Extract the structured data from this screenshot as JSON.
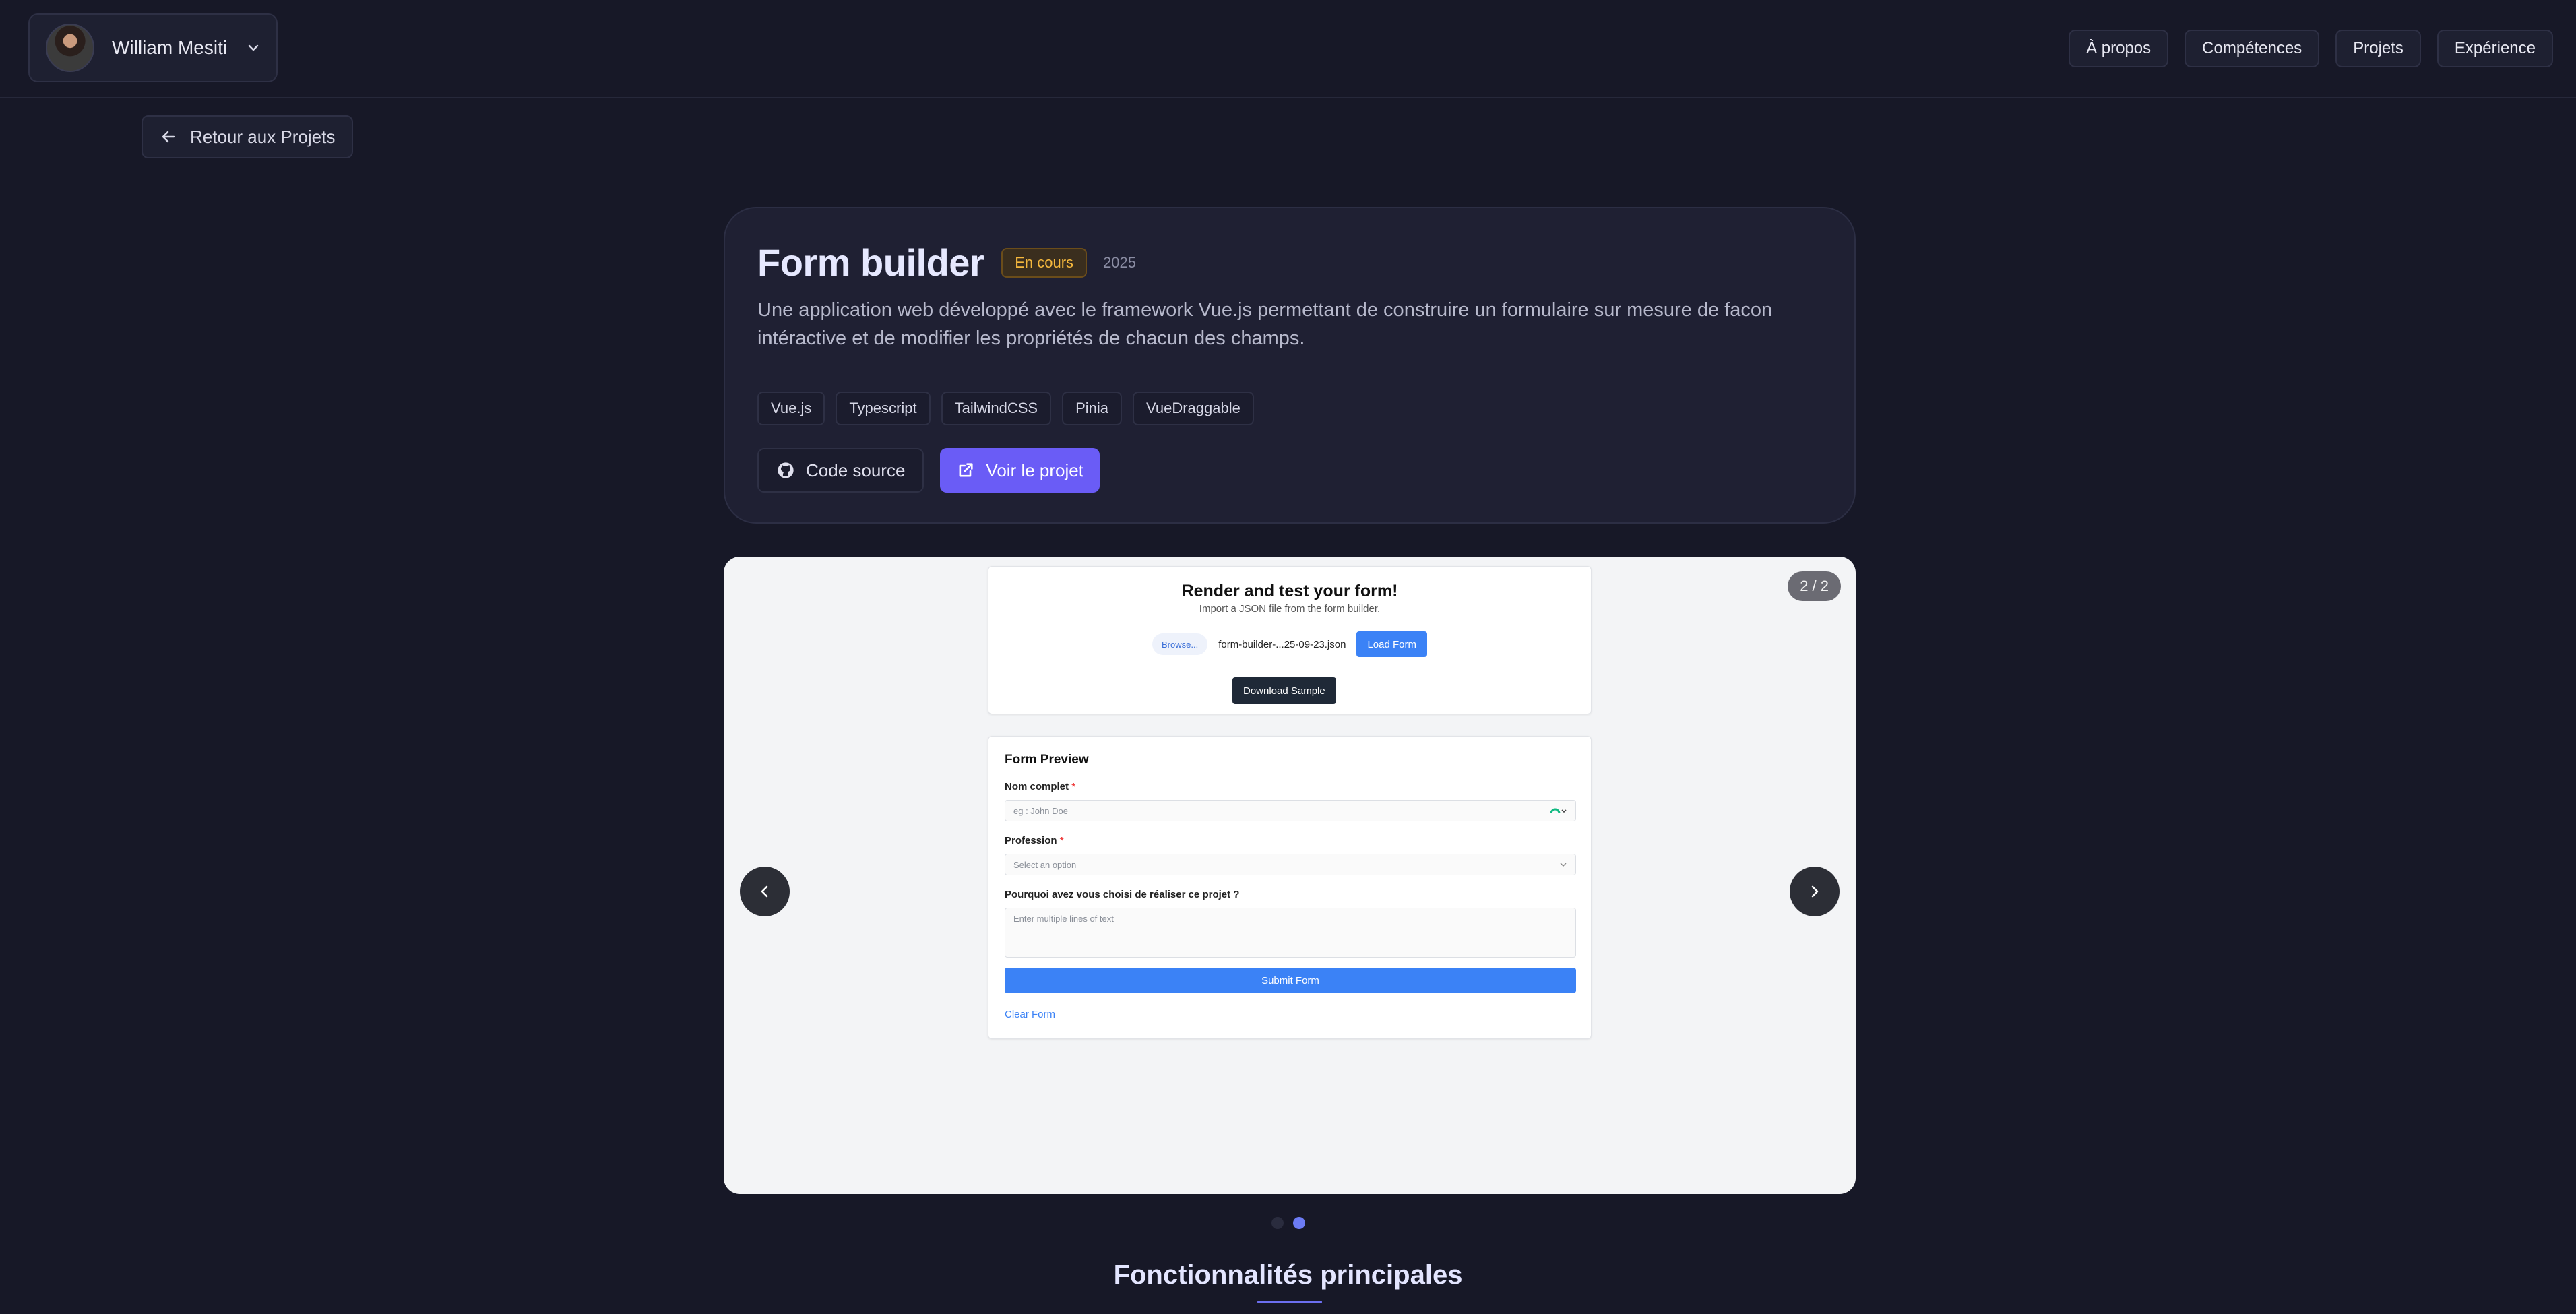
{
  "header": {
    "profile_name": "William Mesiti",
    "nav": [
      "À propos",
      "Compétences",
      "Projets",
      "Expérience"
    ]
  },
  "back_label": "Retour aux Projets",
  "project": {
    "title": "Form builder",
    "status": "En cours",
    "year": "2025",
    "description": "Une application web développé avec le framework Vue.js permettant de construire un formulaire sur mesure de facon intéractive et de modifier les propriétés de chacun des champs.",
    "tags": [
      "Vue.js",
      "Typescript",
      "TailwindCSS",
      "Pinia",
      "VueDraggable"
    ],
    "source_label": "Code source",
    "view_label": "Voir le projet"
  },
  "carousel": {
    "counter": "2 / 2",
    "current_slide": 2,
    "total_slides": 2,
    "slide": {
      "render_title": "Render and test your form!",
      "render_subtitle": "Import a JSON file from the form builder.",
      "browse_label": "Browse...",
      "file_name": "form-builder-...25-09-23.json",
      "load_label": "Load Form",
      "download_label": "Download Sample",
      "preview_title": "Form Preview",
      "fields": [
        {
          "label": "Nom complet",
          "required_mark": "*",
          "placeholder": "eg : John Doe"
        },
        {
          "label": "Profession",
          "required_mark": "*",
          "placeholder": "Select an option"
        },
        {
          "label": "Pourquoi avez vous choisi de réaliser ce projet ?",
          "required_mark": "",
          "placeholder": "Enter multiple lines of text"
        }
      ],
      "submit_label": "Submit Form",
      "clear_label": "Clear Form"
    }
  },
  "features_title": "Fonctionnalités principales",
  "colors": {
    "background": "#171827",
    "accent": "#6a5cf6",
    "status": "#f5b83d",
    "form_primary": "#3b82f6"
  }
}
